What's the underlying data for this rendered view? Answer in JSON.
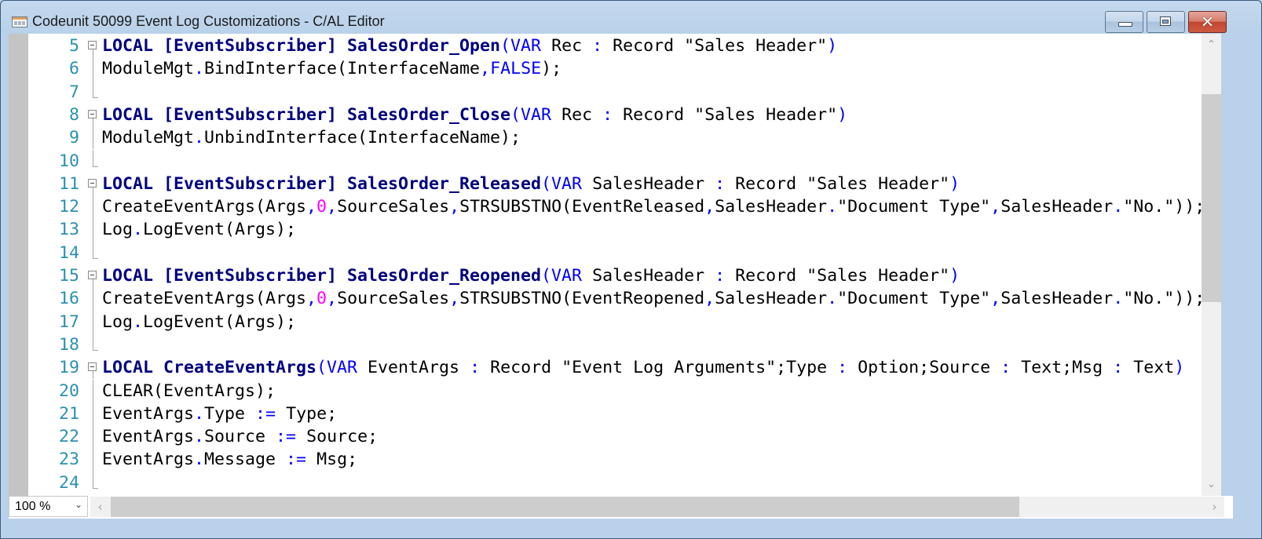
{
  "window": {
    "title": "Codeunit 50099 Event Log Customizations - C/AL Editor",
    "controls": {
      "minimize": "minimize",
      "maximize": "maximize",
      "close": "close"
    }
  },
  "colors": {
    "line_number": "#2b91af",
    "keyword_bold": "#000080",
    "keyword": "#0000ff",
    "operator": "#0000ff",
    "number": "#ff00ff",
    "close_button": "#c2452e"
  },
  "editor": {
    "lines": [
      {
        "n": "5",
        "fold": true,
        "tokens": [
          [
            "kw",
            "LOCAL [EventSubscriber] SalesOrder_Open"
          ],
          [
            "kwv",
            "("
          ],
          [
            "kwv",
            "VAR"
          ],
          [
            "t",
            " Rec "
          ],
          [
            "op",
            ":"
          ],
          [
            "t",
            " Record \"Sales Header\""
          ],
          [
            "kwv",
            ")"
          ]
        ]
      },
      {
        "n": "6",
        "tokens": [
          [
            "t",
            "ModuleMgt"
          ],
          [
            "op",
            "."
          ],
          [
            "t",
            "BindInterface(InterfaceName"
          ],
          [
            "op",
            ","
          ],
          [
            "kwv",
            "FALSE"
          ],
          [
            "t",
            ");"
          ]
        ]
      },
      {
        "n": "7",
        "end": true,
        "tokens": []
      },
      {
        "n": "8",
        "fold": true,
        "tokens": [
          [
            "kw",
            "LOCAL [EventSubscriber] SalesOrder_Close"
          ],
          [
            "kwv",
            "("
          ],
          [
            "kwv",
            "VAR"
          ],
          [
            "t",
            " Rec "
          ],
          [
            "op",
            ":"
          ],
          [
            "t",
            " Record \"Sales Header\""
          ],
          [
            "kwv",
            ")"
          ]
        ]
      },
      {
        "n": "9",
        "tokens": [
          [
            "t",
            "ModuleMgt"
          ],
          [
            "op",
            "."
          ],
          [
            "t",
            "UnbindInterface(InterfaceName);"
          ]
        ]
      },
      {
        "n": "10",
        "end": true,
        "tokens": []
      },
      {
        "n": "11",
        "fold": true,
        "tokens": [
          [
            "kw",
            "LOCAL [EventSubscriber] SalesOrder_Released"
          ],
          [
            "kwv",
            "("
          ],
          [
            "kwv",
            "VAR"
          ],
          [
            "t",
            " SalesHeader "
          ],
          [
            "op",
            ":"
          ],
          [
            "t",
            " Record \"Sales Header\""
          ],
          [
            "kwv",
            ")"
          ]
        ]
      },
      {
        "n": "12",
        "tokens": [
          [
            "t",
            "CreateEventArgs(Args"
          ],
          [
            "op",
            ","
          ],
          [
            "num",
            "0"
          ],
          [
            "op",
            ","
          ],
          [
            "t",
            "SourceSales"
          ],
          [
            "op",
            ","
          ],
          [
            "t",
            "STRSUBSTNO(EventReleased"
          ],
          [
            "op",
            ","
          ],
          [
            "t",
            "SalesHeader"
          ],
          [
            "op",
            "."
          ],
          [
            "t",
            "\"Document Type\""
          ],
          [
            "op",
            ","
          ],
          [
            "t",
            "SalesHeader"
          ],
          [
            "op",
            "."
          ],
          [
            "t",
            "\"No.\"));"
          ]
        ]
      },
      {
        "n": "13",
        "tokens": [
          [
            "t",
            "Log"
          ],
          [
            "op",
            "."
          ],
          [
            "t",
            "LogEvent(Args);"
          ]
        ]
      },
      {
        "n": "14",
        "end": true,
        "tokens": []
      },
      {
        "n": "15",
        "fold": true,
        "tokens": [
          [
            "kw",
            "LOCAL [EventSubscriber] SalesOrder_Reopened"
          ],
          [
            "kwv",
            "("
          ],
          [
            "kwv",
            "VAR"
          ],
          [
            "t",
            " SalesHeader "
          ],
          [
            "op",
            ":"
          ],
          [
            "t",
            " Record \"Sales Header\""
          ],
          [
            "kwv",
            ")"
          ]
        ]
      },
      {
        "n": "16",
        "tokens": [
          [
            "t",
            "CreateEventArgs(Args"
          ],
          [
            "op",
            ","
          ],
          [
            "num",
            "0"
          ],
          [
            "op",
            ","
          ],
          [
            "t",
            "SourceSales"
          ],
          [
            "op",
            ","
          ],
          [
            "t",
            "STRSUBSTNO(EventReopened"
          ],
          [
            "op",
            ","
          ],
          [
            "t",
            "SalesHeader"
          ],
          [
            "op",
            "."
          ],
          [
            "t",
            "\"Document Type\""
          ],
          [
            "op",
            ","
          ],
          [
            "t",
            "SalesHeader"
          ],
          [
            "op",
            "."
          ],
          [
            "t",
            "\"No.\"));"
          ]
        ]
      },
      {
        "n": "17",
        "tokens": [
          [
            "t",
            "Log"
          ],
          [
            "op",
            "."
          ],
          [
            "t",
            "LogEvent(Args);"
          ]
        ]
      },
      {
        "n": "18",
        "end": true,
        "tokens": []
      },
      {
        "n": "19",
        "fold": true,
        "tokens": [
          [
            "kw",
            "LOCAL CreateEventArgs"
          ],
          [
            "kwv",
            "("
          ],
          [
            "kwv",
            "VAR"
          ],
          [
            "t",
            " EventArgs "
          ],
          [
            "op",
            ":"
          ],
          [
            "t",
            " Record \"Event Log Arguments\";Type "
          ],
          [
            "op",
            ":"
          ],
          [
            "t",
            " Option;Source "
          ],
          [
            "op",
            ":"
          ],
          [
            "t",
            " Text;Msg "
          ],
          [
            "op",
            ":"
          ],
          [
            "t",
            " Text"
          ],
          [
            "kwv",
            ")"
          ]
        ]
      },
      {
        "n": "20",
        "tokens": [
          [
            "t",
            "CLEAR(EventArgs);"
          ]
        ]
      },
      {
        "n": "21",
        "tokens": [
          [
            "t",
            "EventArgs"
          ],
          [
            "op",
            "."
          ],
          [
            "t",
            "Type "
          ],
          [
            "op",
            ":="
          ],
          [
            "t",
            " Type;"
          ]
        ]
      },
      {
        "n": "22",
        "tokens": [
          [
            "t",
            "EventArgs"
          ],
          [
            "op",
            "."
          ],
          [
            "t",
            "Source "
          ],
          [
            "op",
            ":="
          ],
          [
            "t",
            " Source;"
          ]
        ]
      },
      {
        "n": "23",
        "tokens": [
          [
            "t",
            "EventArgs"
          ],
          [
            "op",
            "."
          ],
          [
            "t",
            "Message "
          ],
          [
            "op",
            ":="
          ],
          [
            "t",
            " Msg;"
          ]
        ]
      },
      {
        "n": "24",
        "end": true,
        "tokens": []
      }
    ]
  },
  "scrollbars": {
    "vertical": {
      "up_icon": "chevron-up",
      "down_icon": "chevron-down",
      "up_glyph": "⌃",
      "down_glyph": "⌄"
    },
    "horizontal": {
      "left_icon": "chevron-left",
      "right_icon": "chevron-right",
      "left_glyph": "‹",
      "right_glyph": "›"
    }
  },
  "statusbar": {
    "zoom_value": "100 %",
    "zoom_arrow": "⌄"
  }
}
